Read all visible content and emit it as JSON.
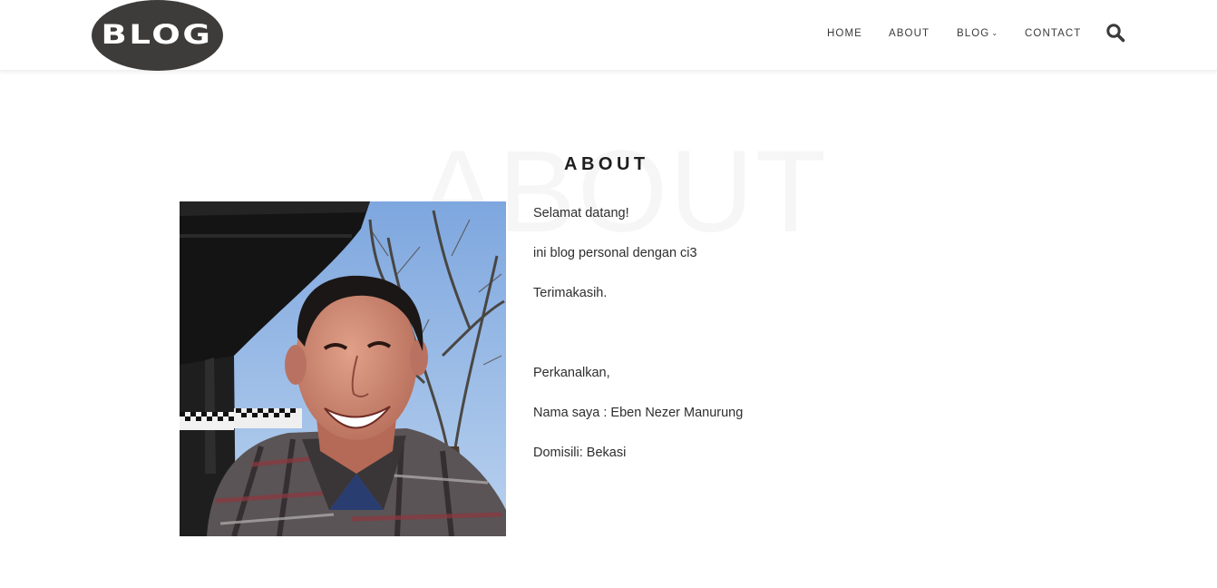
{
  "header": {
    "logo_text": "BLOG",
    "nav": {
      "home": "HOME",
      "about": "ABOUT",
      "blog": "BLOG",
      "contact": "CONTACT"
    },
    "icons": {
      "blog_dropdown": "chevron-down-icon",
      "search": "search-icon"
    }
  },
  "main": {
    "background_word": "ABOUT",
    "title": "ABOUT",
    "paragraphs": [
      "Selamat datang!",
      "ini blog personal dengan ci3",
      "Terimakasih.",
      "",
      "Perkanalkan,",
      "Nama saya : Eben Nezer Manurung",
      "Domisili: Bekasi"
    ]
  },
  "colors": {
    "logo_bg": "#3e3c3a",
    "text": "#2e2e2e",
    "title": "#1e1e1e",
    "watermark": "#f6f6f6"
  }
}
